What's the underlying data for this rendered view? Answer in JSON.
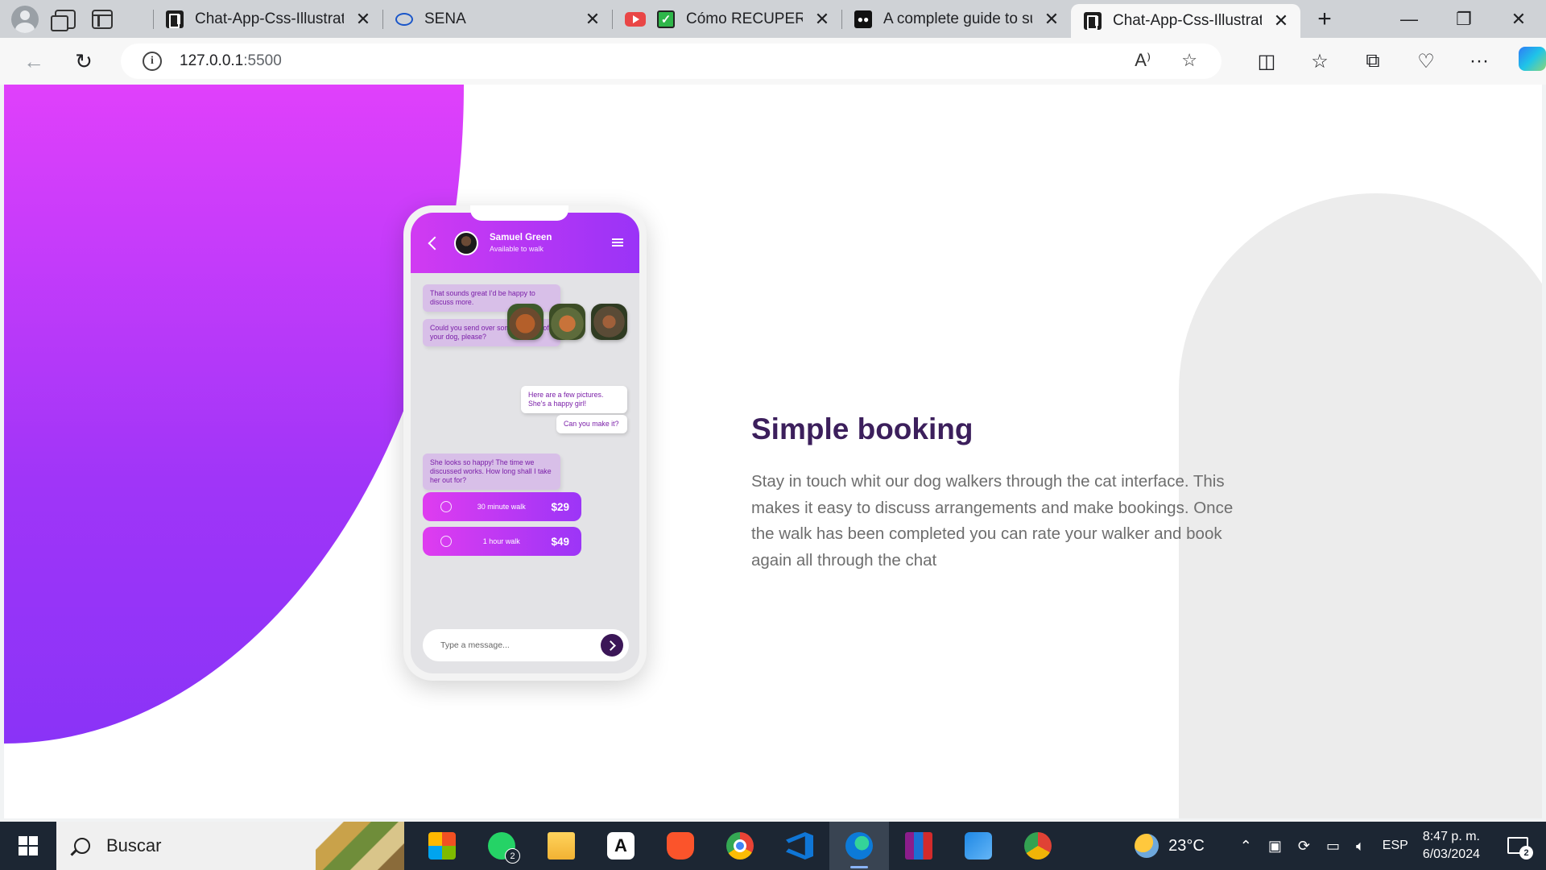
{
  "browser": {
    "tabs": [
      {
        "title": "Chat-App-Css-Illustratio",
        "favicon": "code-page-icon",
        "active": false
      },
      {
        "title": "SENA",
        "favicon": "eye-icon",
        "active": false
      },
      {
        "title": "Cómo RECUPERAR",
        "favicon": "youtube-icon",
        "active": false
      },
      {
        "title": "A complete guide to su",
        "favicon": "medium-icon",
        "active": false
      },
      {
        "title": "Chat-App-Css-Illustratio",
        "favicon": "code-page-icon",
        "active": true
      }
    ],
    "address": {
      "host": "127.0.0.1",
      "port": ":5500"
    }
  },
  "phone": {
    "contact_name": "Samuel Green",
    "contact_status": "Available to walk",
    "messages": [
      {
        "side": "in",
        "text": "That sounds great I'd be happy to discuss more."
      },
      {
        "side": "in",
        "text": "Could you send over some pictures of your dog, please?"
      },
      {
        "side": "out",
        "text": "Here are a few pictures. She's a happy girl!"
      },
      {
        "side": "out",
        "text": "Can you make it?"
      },
      {
        "side": "in",
        "text": "She looks so happy! The time we discussed works. How long shall I take her out for?"
      }
    ],
    "options": [
      {
        "label": "30 minute walk",
        "price": "$29"
      },
      {
        "label": "1 hour walk",
        "price": "$49"
      }
    ],
    "input_placeholder": "Type a message..."
  },
  "feature": {
    "title": "Simple booking",
    "body": "Stay in touch whit our dog walkers through the cat interface. This makes it easy to discuss arrangements and make bookings. Once the walk has been completed you can rate your walker and book again all through the chat"
  },
  "colors": {
    "accent_pink": "#e040fb",
    "accent_purple": "#8a33f7",
    "title_color": "#3c1f5c"
  },
  "taskbar": {
    "search_placeholder": "Buscar",
    "whatsapp_badge": "2",
    "weather": "23°C",
    "language": "ESP",
    "time": "8:47 p. m.",
    "date": "6/03/2024",
    "notifications": "2"
  }
}
